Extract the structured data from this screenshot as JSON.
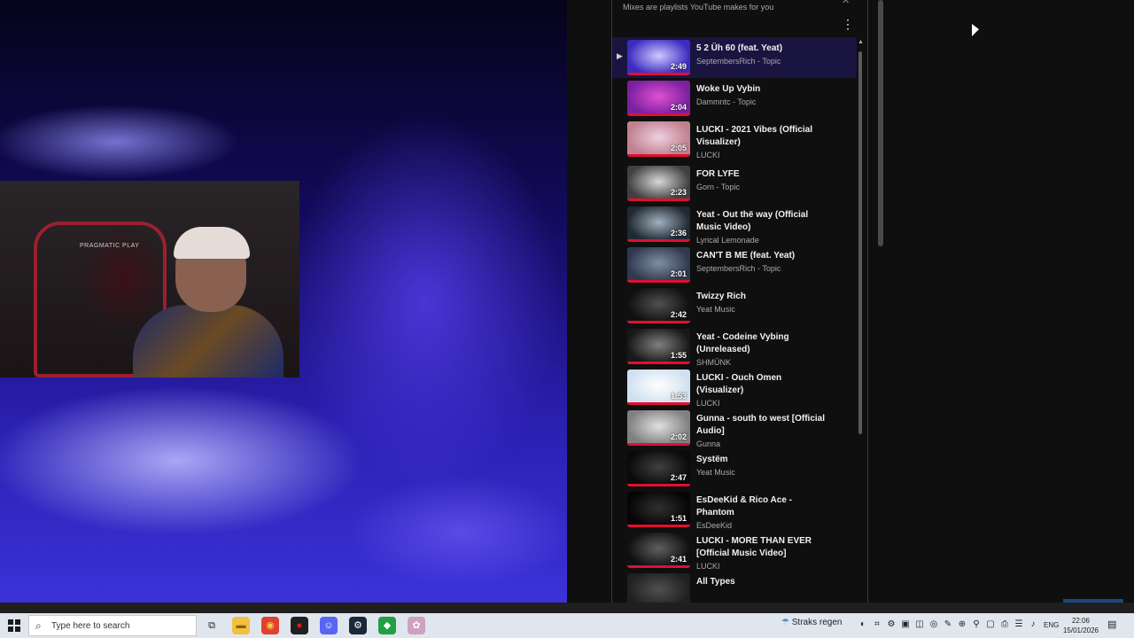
{
  "panel": {
    "subtitle": "Mixes are playlists YouTube makes for you",
    "more_icon": "⋮",
    "close_icon": "✕",
    "items": [
      {
        "title": "5 2 Üh 60 (feat. Yeat)",
        "channel": "SeptembersRich - Topic",
        "duration": "2:49",
        "active": true,
        "colors": [
          "#3a2cc0",
          "#d0c8ff"
        ]
      },
      {
        "title": "Woke Up Vybin",
        "channel": "Dammntc - Topic",
        "duration": "2:04",
        "colors": [
          "#7a20a0",
          "#e050d0"
        ]
      },
      {
        "title": "LUCKI - 2021 Vibes (Official Visualizer)",
        "channel": "LUCKI",
        "duration": "2:05",
        "colors": [
          "#c08090",
          "#f0d0e0"
        ]
      },
      {
        "title": "FOR LYFE",
        "channel": "Gorn - Topic",
        "duration": "2:23",
        "colors": [
          "#404040",
          "#d8d8d8"
        ]
      },
      {
        "title": "Yeat - Out thë way (Official Music Video)",
        "channel": "Lyrical Lemonade",
        "duration": "2:36",
        "colors": [
          "#202830",
          "#a0b0c0"
        ]
      },
      {
        "title": "CAN'T B ME (feat. Yeat)",
        "channel": "SeptembersRich - Topic",
        "duration": "2:01",
        "colors": [
          "#303850",
          "#8090a0"
        ]
      },
      {
        "title": "Twizzy Rich",
        "channel": "Yeat Music",
        "duration": "2:42",
        "colors": [
          "#101010",
          "#505050"
        ]
      },
      {
        "title": "Yeat - Codeine Vybing (Unreleased)",
        "channel": "SHMÜNK",
        "duration": "1:55",
        "colors": [
          "#181818",
          "#808080"
        ]
      },
      {
        "title": "LUCKI - Ouch Omen (Visualizer)",
        "channel": "LUCKI",
        "duration": "1:53",
        "colors": [
          "#d0e0f0",
          "#ffffff"
        ]
      },
      {
        "title": "Gunna - south to west [Official Audio]",
        "channel": "Gunna",
        "duration": "2:02",
        "colors": [
          "#808080",
          "#e0e0e0"
        ]
      },
      {
        "title": "Systëm",
        "channel": "Yeat Music",
        "duration": "2:47",
        "colors": [
          "#0a0a0a",
          "#404040"
        ]
      },
      {
        "title": "EsDeeKid & Rico Ace - Phantom",
        "channel": "EsDeeKid",
        "duration": "1:51",
        "colors": [
          "#050505",
          "#303030"
        ]
      },
      {
        "title": "LUCKI - MORE THAN EVER [Official Music Video]",
        "channel": "LUCKI",
        "duration": "2:41",
        "colors": [
          "#101010",
          "#606060"
        ]
      },
      {
        "title": "All Types",
        "channel": "",
        "duration": "",
        "colors": [
          "#202020",
          "#505050"
        ]
      }
    ]
  },
  "webcam": {
    "chair_brand": "PRAGMATIC PLAY"
  },
  "taskbar": {
    "search_placeholder": "Type here to search",
    "search_icon": "⌕",
    "weather": "Straks regen",
    "weather_icon": "☂",
    "language": "ENG",
    "time": "22:06",
    "date": "15/01/2026",
    "notification_icon": "▤",
    "apps": [
      {
        "name": "task-view-icon",
        "glyph": "⧉",
        "bg": "transparent",
        "fg": "#222"
      },
      {
        "name": "file-explorer-icon",
        "glyph": "▬",
        "bg": "#f2c040",
        "fg": "#8a6010"
      },
      {
        "name": "chrome-icon",
        "glyph": "◉",
        "bg": "#e04030",
        "fg": "#f0d040"
      },
      {
        "name": "app-red-icon",
        "glyph": "●",
        "bg": "#202020",
        "fg": "#e02020"
      },
      {
        "name": "discord-icon",
        "glyph": "☺",
        "bg": "#5865f2",
        "fg": "#fff"
      },
      {
        "name": "steam-icon",
        "glyph": "⚙",
        "bg": "#1b2838",
        "fg": "#fff"
      },
      {
        "name": "app-green-icon",
        "glyph": "◆",
        "bg": "#20a040",
        "fg": "#fff"
      },
      {
        "name": "app-pink-icon",
        "glyph": "✿",
        "bg": "#d0a0c0",
        "fg": "#fff"
      }
    ],
    "tray": [
      "◐",
      "⌗",
      "⚙",
      "▣",
      "◫",
      "◎",
      "✎",
      "⊕",
      "⚲",
      "▢",
      "⎙",
      "☰",
      "♪"
    ]
  }
}
